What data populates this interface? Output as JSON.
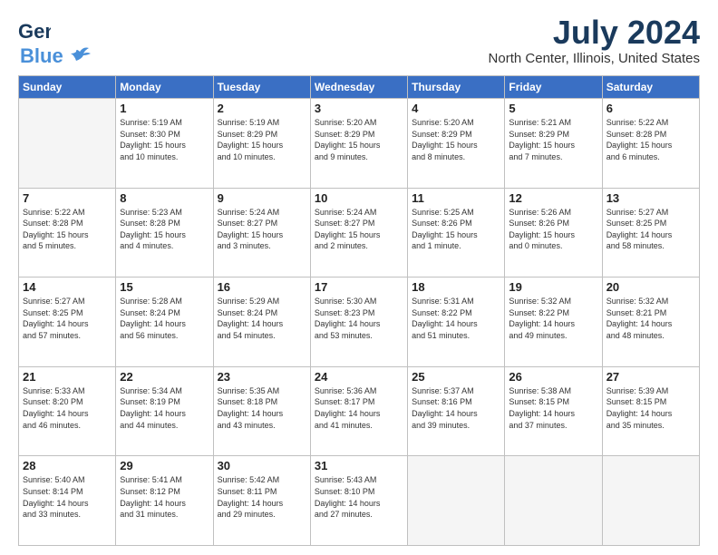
{
  "header": {
    "logo_line1": "General",
    "logo_line2": "Blue",
    "month": "July 2024",
    "location": "North Center, Illinois, United States"
  },
  "weekdays": [
    "Sunday",
    "Monday",
    "Tuesday",
    "Wednesday",
    "Thursday",
    "Friday",
    "Saturday"
  ],
  "weeks": [
    [
      {
        "day": "",
        "info": ""
      },
      {
        "day": "1",
        "info": "Sunrise: 5:19 AM\nSunset: 8:30 PM\nDaylight: 15 hours\nand 10 minutes."
      },
      {
        "day": "2",
        "info": "Sunrise: 5:19 AM\nSunset: 8:29 PM\nDaylight: 15 hours\nand 10 minutes."
      },
      {
        "day": "3",
        "info": "Sunrise: 5:20 AM\nSunset: 8:29 PM\nDaylight: 15 hours\nand 9 minutes."
      },
      {
        "day": "4",
        "info": "Sunrise: 5:20 AM\nSunset: 8:29 PM\nDaylight: 15 hours\nand 8 minutes."
      },
      {
        "day": "5",
        "info": "Sunrise: 5:21 AM\nSunset: 8:29 PM\nDaylight: 15 hours\nand 7 minutes."
      },
      {
        "day": "6",
        "info": "Sunrise: 5:22 AM\nSunset: 8:28 PM\nDaylight: 15 hours\nand 6 minutes."
      }
    ],
    [
      {
        "day": "7",
        "info": "Sunrise: 5:22 AM\nSunset: 8:28 PM\nDaylight: 15 hours\nand 5 minutes."
      },
      {
        "day": "8",
        "info": "Sunrise: 5:23 AM\nSunset: 8:28 PM\nDaylight: 15 hours\nand 4 minutes."
      },
      {
        "day": "9",
        "info": "Sunrise: 5:24 AM\nSunset: 8:27 PM\nDaylight: 15 hours\nand 3 minutes."
      },
      {
        "day": "10",
        "info": "Sunrise: 5:24 AM\nSunset: 8:27 PM\nDaylight: 15 hours\nand 2 minutes."
      },
      {
        "day": "11",
        "info": "Sunrise: 5:25 AM\nSunset: 8:26 PM\nDaylight: 15 hours\nand 1 minute."
      },
      {
        "day": "12",
        "info": "Sunrise: 5:26 AM\nSunset: 8:26 PM\nDaylight: 15 hours\nand 0 minutes."
      },
      {
        "day": "13",
        "info": "Sunrise: 5:27 AM\nSunset: 8:25 PM\nDaylight: 14 hours\nand 58 minutes."
      }
    ],
    [
      {
        "day": "14",
        "info": "Sunrise: 5:27 AM\nSunset: 8:25 PM\nDaylight: 14 hours\nand 57 minutes."
      },
      {
        "day": "15",
        "info": "Sunrise: 5:28 AM\nSunset: 8:24 PM\nDaylight: 14 hours\nand 56 minutes."
      },
      {
        "day": "16",
        "info": "Sunrise: 5:29 AM\nSunset: 8:24 PM\nDaylight: 14 hours\nand 54 minutes."
      },
      {
        "day": "17",
        "info": "Sunrise: 5:30 AM\nSunset: 8:23 PM\nDaylight: 14 hours\nand 53 minutes."
      },
      {
        "day": "18",
        "info": "Sunrise: 5:31 AM\nSunset: 8:22 PM\nDaylight: 14 hours\nand 51 minutes."
      },
      {
        "day": "19",
        "info": "Sunrise: 5:32 AM\nSunset: 8:22 PM\nDaylight: 14 hours\nand 49 minutes."
      },
      {
        "day": "20",
        "info": "Sunrise: 5:32 AM\nSunset: 8:21 PM\nDaylight: 14 hours\nand 48 minutes."
      }
    ],
    [
      {
        "day": "21",
        "info": "Sunrise: 5:33 AM\nSunset: 8:20 PM\nDaylight: 14 hours\nand 46 minutes."
      },
      {
        "day": "22",
        "info": "Sunrise: 5:34 AM\nSunset: 8:19 PM\nDaylight: 14 hours\nand 44 minutes."
      },
      {
        "day": "23",
        "info": "Sunrise: 5:35 AM\nSunset: 8:18 PM\nDaylight: 14 hours\nand 43 minutes."
      },
      {
        "day": "24",
        "info": "Sunrise: 5:36 AM\nSunset: 8:17 PM\nDaylight: 14 hours\nand 41 minutes."
      },
      {
        "day": "25",
        "info": "Sunrise: 5:37 AM\nSunset: 8:16 PM\nDaylight: 14 hours\nand 39 minutes."
      },
      {
        "day": "26",
        "info": "Sunrise: 5:38 AM\nSunset: 8:15 PM\nDaylight: 14 hours\nand 37 minutes."
      },
      {
        "day": "27",
        "info": "Sunrise: 5:39 AM\nSunset: 8:15 PM\nDaylight: 14 hours\nand 35 minutes."
      }
    ],
    [
      {
        "day": "28",
        "info": "Sunrise: 5:40 AM\nSunset: 8:14 PM\nDaylight: 14 hours\nand 33 minutes."
      },
      {
        "day": "29",
        "info": "Sunrise: 5:41 AM\nSunset: 8:12 PM\nDaylight: 14 hours\nand 31 minutes."
      },
      {
        "day": "30",
        "info": "Sunrise: 5:42 AM\nSunset: 8:11 PM\nDaylight: 14 hours\nand 29 minutes."
      },
      {
        "day": "31",
        "info": "Sunrise: 5:43 AM\nSunset: 8:10 PM\nDaylight: 14 hours\nand 27 minutes."
      },
      {
        "day": "",
        "info": ""
      },
      {
        "day": "",
        "info": ""
      },
      {
        "day": "",
        "info": ""
      }
    ]
  ]
}
